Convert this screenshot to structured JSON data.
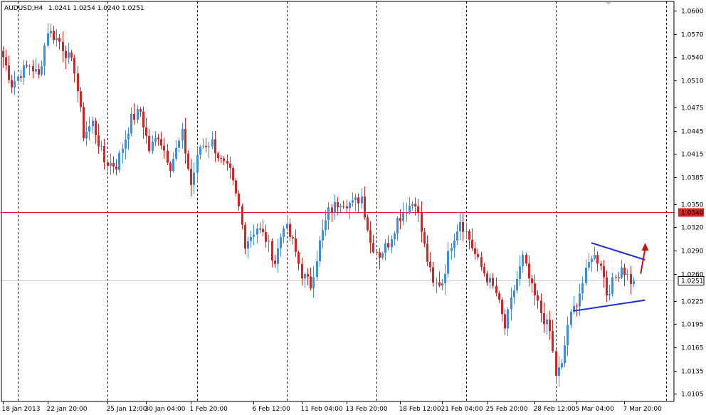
{
  "header": {
    "symbol_label": "AUDUSD,H4",
    "ohlc_label": "1.0241 1.0254 1.0240 1.0251"
  },
  "colors": {
    "bull": "#3a8ee6",
    "bear": "#e02020",
    "resistance": "#e02020",
    "current_price": "#c8c8c8",
    "trendline": "#1a2ad8",
    "arrow": "#c81010",
    "grid": "#000000",
    "price_tag_bg": "#e02020",
    "bid_tag_bg": "#ffffff"
  },
  "chart_data": {
    "type": "candlestick",
    "title": "AUDUSD,H4",
    "y_ticks": [
      1.06,
      1.057,
      1.054,
      1.051,
      1.0475,
      1.0445,
      1.0415,
      1.0385,
      1.035,
      1.032,
      1.029,
      1.026,
      1.0225,
      1.0195,
      1.0165,
      1.0135,
      1.0105
    ],
    "y_ticks_text": [
      "1.0600",
      "1.0570",
      "1.0540",
      "1.0510",
      "1.0475",
      "1.0445",
      "1.0415",
      "1.0385",
      "1.0350",
      "1.0320",
      "1.0290",
      "1.0260",
      "1.0225",
      "1.0195",
      "1.0165",
      "1.0135",
      "1.0105"
    ],
    "ylim": [
      1.0095,
      1.0612
    ],
    "x_ticks": [
      "18 Jan 2013",
      "22 Jan 20:00",
      "25 Jan 12:00",
      "30 Jan 04:00",
      "1 Feb 20:00",
      "6 Feb 12:00",
      "11 Feb 04:00",
      "13 Feb 20:00",
      "18 Feb 12:00",
      "21 Feb 04:00",
      "25 Feb 20:00",
      "28 Feb 12:00",
      "5 Mar 04:00",
      "7 Mar 20:00"
    ],
    "x_ticks_index": [
      0,
      15,
      35,
      48,
      63,
      84,
      100,
      115,
      133,
      147,
      162,
      178,
      192,
      208
    ],
    "vgrid_index": [
      5,
      35,
      65,
      95,
      125,
      155,
      185,
      222
    ],
    "resistance_level": 1.034,
    "resistance_label": "1.0340",
    "current_price": 1.0251,
    "current_price_label": "1.0251",
    "candle_count": 212,
    "pivots": [
      [
        0,
        1.054
      ],
      [
        3,
        1.0505
      ],
      [
        6,
        1.052
      ],
      [
        9,
        1.053
      ],
      [
        12,
        1.0515
      ],
      [
        15,
        1.0575
      ],
      [
        19,
        1.056
      ],
      [
        24,
        1.0525
      ],
      [
        27,
        1.044
      ],
      [
        30,
        1.0455
      ],
      [
        34,
        1.0405
      ],
      [
        38,
        1.04
      ],
      [
        43,
        1.046
      ],
      [
        46,
        1.047
      ],
      [
        49,
        1.042
      ],
      [
        52,
        1.044
      ],
      [
        56,
        1.04
      ],
      [
        60,
        1.044
      ],
      [
        63,
        1.0375
      ],
      [
        66,
        1.0425
      ],
      [
        70,
        1.043
      ],
      [
        73,
        1.0405
      ],
      [
        76,
        1.039
      ],
      [
        79,
        1.0345
      ],
      [
        81,
        1.03
      ],
      [
        85,
        1.032
      ],
      [
        88,
        1.0305
      ],
      [
        91,
        1.0275
      ],
      [
        94,
        1.0325
      ],
      [
        97,
        1.03
      ],
      [
        100,
        1.026
      ],
      [
        103,
        1.0245
      ],
      [
        106,
        1.03
      ],
      [
        109,
        1.034
      ],
      [
        113,
        1.0355
      ],
      [
        117,
        1.035
      ],
      [
        120,
        1.036
      ],
      [
        123,
        1.03
      ],
      [
        126,
        1.0285
      ],
      [
        129,
        1.03
      ],
      [
        132,
        1.033
      ],
      [
        135,
        1.0345
      ],
      [
        138,
        1.0355
      ],
      [
        141,
        1.0295
      ],
      [
        144,
        1.0245
      ],
      [
        147,
        1.025
      ],
      [
        150,
        1.03
      ],
      [
        153,
        1.033
      ],
      [
        156,
        1.0305
      ],
      [
        159,
        1.0275
      ],
      [
        162,
        1.0255
      ],
      [
        165,
        1.0235
      ],
      [
        168,
        1.019
      ],
      [
        171,
        1.024
      ],
      [
        174,
        1.028
      ],
      [
        177,
        1.024
      ],
      [
        180,
        1.021
      ],
      [
        183,
        1.0185
      ],
      [
        185,
        1.013
      ],
      [
        187,
        1.014
      ],
      [
        189,
        1.0195
      ],
      [
        192,
        1.0225
      ],
      [
        195,
        1.026
      ],
      [
        197,
        1.0285
      ],
      [
        200,
        1.0275
      ],
      [
        202,
        1.0235
      ],
      [
        205,
        1.0255
      ],
      [
        207,
        1.027
      ],
      [
        210,
        1.0251
      ]
    ],
    "trendlines": [
      {
        "name": "upper",
        "from": [
          197,
          1.03
        ],
        "to": [
          215,
          1.0278
        ]
      },
      {
        "name": "lower",
        "from": [
          191,
          1.0212
        ],
        "to": [
          215,
          1.0226
        ]
      }
    ],
    "arrow": {
      "from": [
        213.5,
        1.026
      ],
      "to": [
        215,
        1.03
      ]
    }
  }
}
